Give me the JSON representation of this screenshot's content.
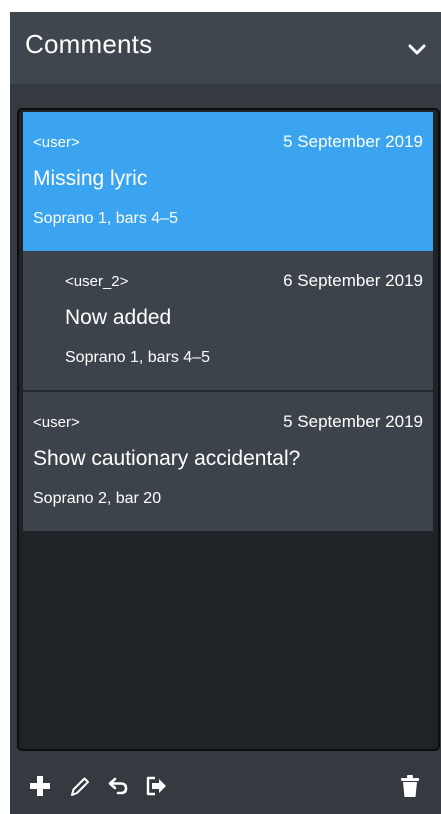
{
  "header": {
    "title": "Comments",
    "collapse_icon": "chevron-down-icon"
  },
  "comments": [
    {
      "user": "<user>",
      "date": "5 September 2019",
      "text": "Missing lyric",
      "location": "Soprano 1, bars 4–5",
      "selected": true,
      "is_reply": false
    },
    {
      "user": "<user_2>",
      "date": "6 September 2019",
      "text": "Now added",
      "location": "Soprano 1, bars 4–5",
      "selected": false,
      "is_reply": true
    },
    {
      "user": "<user>",
      "date": "5 September 2019",
      "text": "Show cautionary accidental?",
      "location": "Soprano 2, bar 20",
      "selected": false,
      "is_reply": false
    }
  ],
  "toolbar": {
    "buttons": [
      "add-icon",
      "edit-icon",
      "reply-icon",
      "export-icon",
      "delete-icon"
    ]
  },
  "colors": {
    "selected": "#3aa4f1",
    "panel": "#343a40",
    "header": "#3f464d",
    "comment": "#3d434a",
    "list_background": "#1f2327"
  }
}
